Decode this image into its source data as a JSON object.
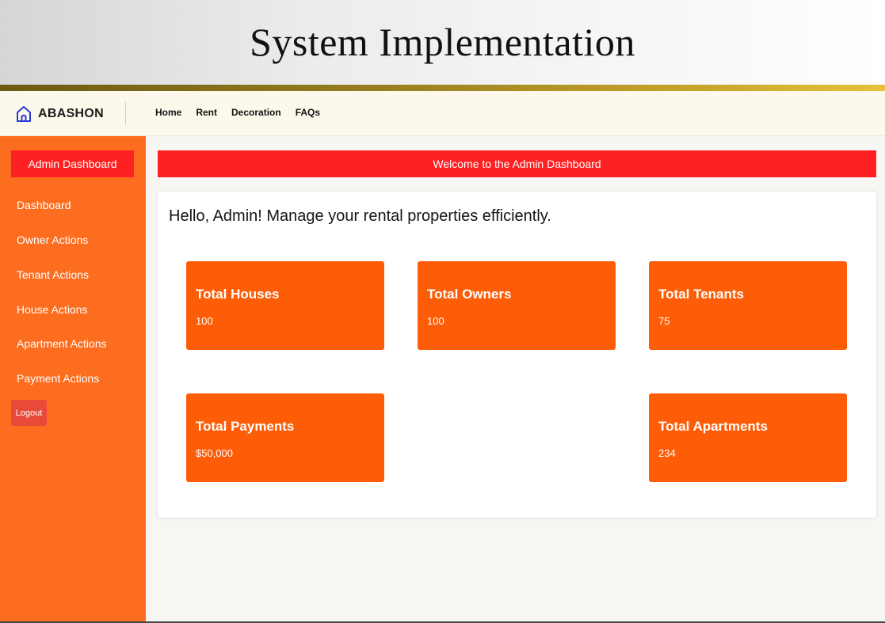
{
  "slide": {
    "title": "System Implementation"
  },
  "nav": {
    "brand": "ABASHON",
    "brand_icon": "home-icon",
    "links": [
      "Home",
      "Rent",
      "Decoration",
      "FAQs"
    ]
  },
  "sidebar": {
    "title": "Admin Dashboard",
    "items": [
      "Dashboard",
      "Owner Actions",
      "Tenant Actions",
      "House Actions",
      "Apartment Actions",
      "Payment Actions"
    ],
    "logout": "Logout"
  },
  "main": {
    "welcome": "Welcome to the Admin Dashboard",
    "greeting": "Hello, Admin! Manage your rental properties efficiently.",
    "cards": [
      {
        "title": "Total Houses",
        "value": "100"
      },
      {
        "title": "Total Owners",
        "value": "100"
      },
      {
        "title": "Total Tenants",
        "value": "75"
      },
      {
        "title": "Total Payments",
        "value": "$50,000"
      },
      {
        "title": "Total Apartments",
        "value": "234"
      }
    ]
  },
  "colors": {
    "sidebar": "#fc6d1f",
    "accent_red": "#ff2121",
    "card": "#fe5d07",
    "logout": "#e84a3a"
  }
}
